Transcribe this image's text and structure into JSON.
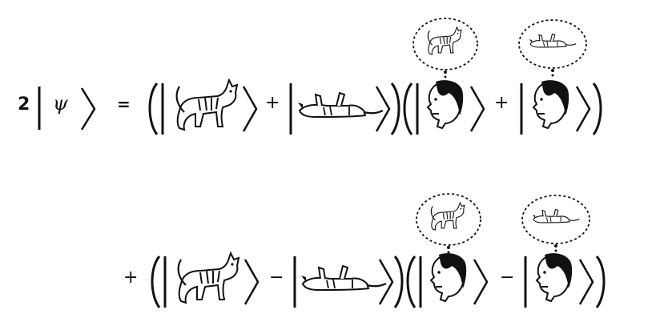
{
  "equation": {
    "line1": {
      "coefficient": "2",
      "state": "ψ",
      "equals": "=",
      "plus_1": "+",
      "plus_2": "+"
    },
    "line2": {
      "leading_plus": "+",
      "minus_1": "−",
      "minus_2": "−"
    }
  }
}
